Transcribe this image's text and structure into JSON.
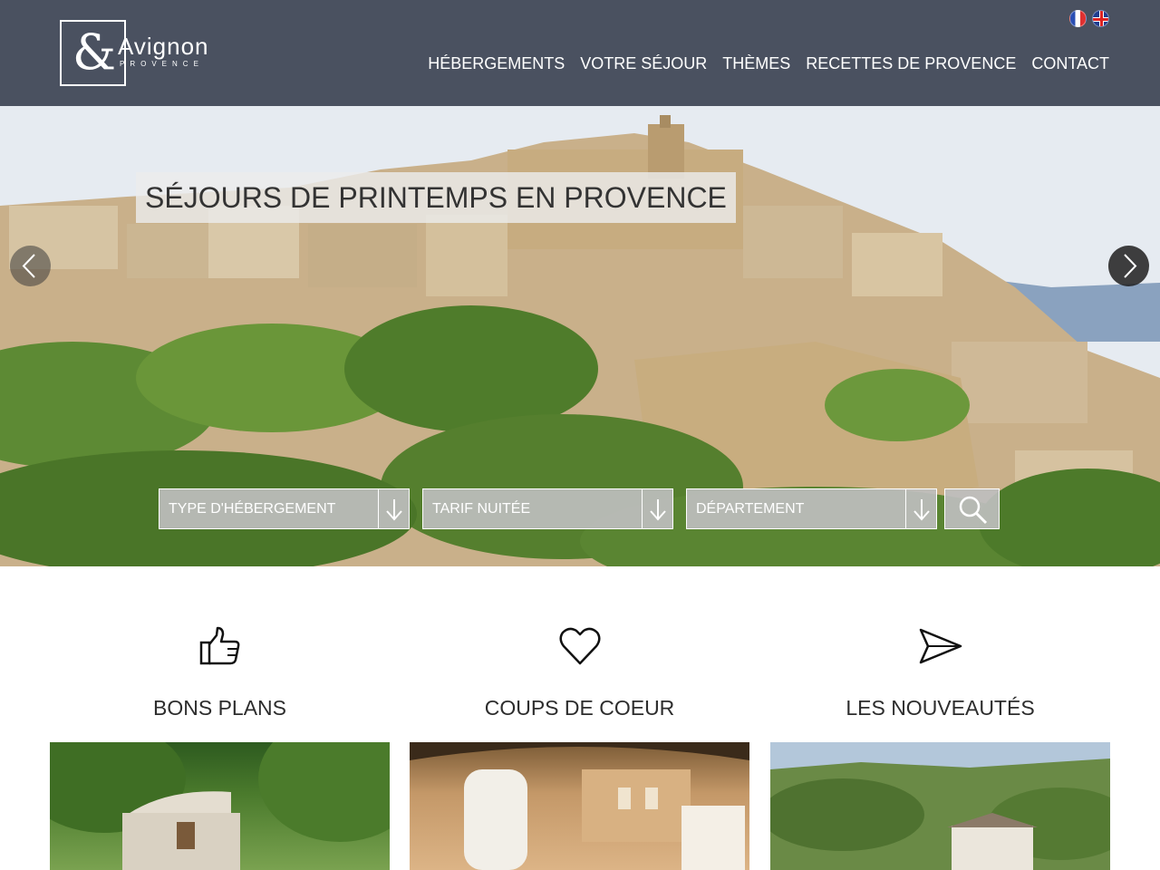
{
  "header": {
    "logo": {
      "symbol": "&",
      "name": "Avignon",
      "subtitle": "PROVENCE"
    },
    "languages": [
      {
        "code": "fr",
        "icon": "france-flag-icon"
      },
      {
        "code": "en",
        "icon": "uk-flag-icon"
      }
    ],
    "nav": [
      {
        "label": "HÉBERGEMENTS"
      },
      {
        "label": "VOTRE SÉJOUR"
      },
      {
        "label": "THÈMES"
      },
      {
        "label": "RECETTES DE PROVENCE"
      },
      {
        "label": "CONTACT"
      }
    ]
  },
  "hero": {
    "title": "SÉJOURS DE PRINTEMPS EN PROVENCE",
    "prev_icon": "chevron-left-icon",
    "next_icon": "chevron-right-icon",
    "filters": [
      {
        "label": "TYPE D'HÉBERGEMENT"
      },
      {
        "label": "TARIF NUITÉE"
      },
      {
        "label": "DÉPARTEMENT"
      }
    ],
    "search_icon": "search-icon"
  },
  "features": [
    {
      "title": "BONS PLANS",
      "icon": "thumbs-up-icon"
    },
    {
      "title": "COUPS DE COEUR",
      "icon": "heart-icon"
    },
    {
      "title": "LES NOUVEAUTÉS",
      "icon": "paper-plane-icon"
    }
  ],
  "colors": {
    "header_bg": "#4a5160",
    "nav_text": "#ffffff",
    "select_bg": "#bebebe",
    "slider_arrow": "#1e1e1e"
  }
}
